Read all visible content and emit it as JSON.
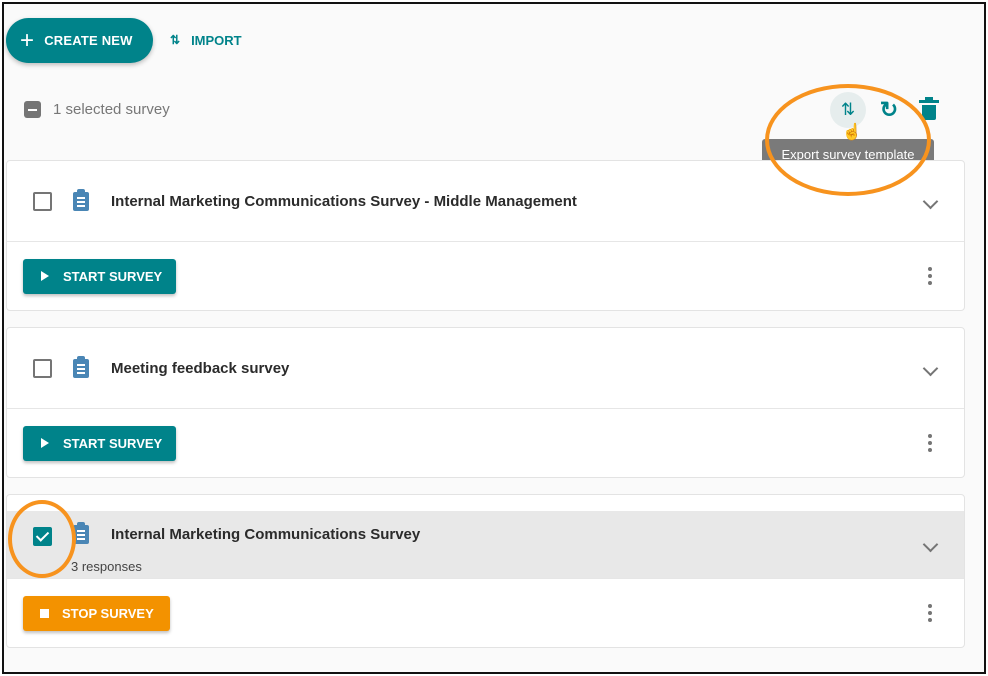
{
  "toolbar": {
    "create_new_label": "CREATE NEW",
    "create_new_icon": "plus-icon",
    "import_label": "IMPORT",
    "import_icon": "swap-vertical-icon"
  },
  "selection": {
    "status_text": "1 selected survey",
    "actions": [
      {
        "name": "export",
        "icon": "swap-vertical-icon",
        "tooltip": "Export survey template"
      },
      {
        "name": "refresh",
        "icon": "refresh-icon"
      },
      {
        "name": "delete",
        "icon": "trash-icon"
      }
    ],
    "tooltip_text": "Export survey template"
  },
  "surveys": [
    {
      "title": "Internal Marketing Communications Survey - Middle Management",
      "checked": false,
      "responses": "",
      "action_label": "START SURVEY",
      "action_type": "start"
    },
    {
      "title": "Meeting feedback survey",
      "checked": false,
      "responses": "",
      "action_label": "START SURVEY",
      "action_type": "start"
    },
    {
      "title": "Internal Marketing Communications Survey",
      "checked": true,
      "responses": "3 responses",
      "action_label": "STOP SURVEY",
      "action_type": "stop"
    }
  ],
  "colors": {
    "primary": "#00838a",
    "stop": "#f39200",
    "annotation": "#f7931e",
    "clipboard": "#4a86b5"
  }
}
